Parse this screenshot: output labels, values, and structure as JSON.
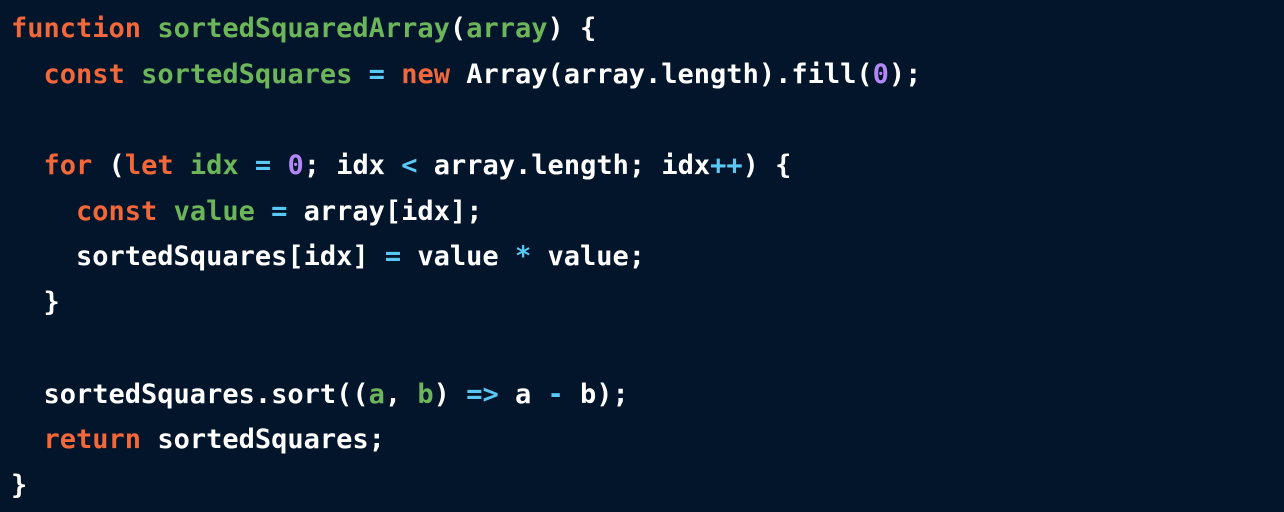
{
  "colors": {
    "background": "#02152a",
    "keyword": "#f2683b",
    "declaration": "#6cb55a",
    "operator": "#5ac8f5",
    "number": "#b387f7",
    "plain": "#ffffff"
  },
  "code": {
    "lines": [
      [
        {
          "text": "function",
          "kind": "kw"
        },
        {
          "text": " ",
          "kind": "id"
        },
        {
          "text": "sortedSquaredArray",
          "kind": "fn"
        },
        {
          "text": "(",
          "kind": "id"
        },
        {
          "text": "array",
          "kind": "fn"
        },
        {
          "text": ") {",
          "kind": "id"
        }
      ],
      [
        {
          "text": "  ",
          "kind": "id"
        },
        {
          "text": "const",
          "kind": "kw"
        },
        {
          "text": " ",
          "kind": "id"
        },
        {
          "text": "sortedSquares",
          "kind": "fn"
        },
        {
          "text": " ",
          "kind": "id"
        },
        {
          "text": "=",
          "kind": "op"
        },
        {
          "text": " ",
          "kind": "id"
        },
        {
          "text": "new",
          "kind": "kw"
        },
        {
          "text": " Array(array.length).fill(",
          "kind": "id"
        },
        {
          "text": "0",
          "kind": "num"
        },
        {
          "text": ");",
          "kind": "id"
        }
      ],
      [],
      [
        {
          "text": "  ",
          "kind": "id"
        },
        {
          "text": "for",
          "kind": "kw"
        },
        {
          "text": " (",
          "kind": "id"
        },
        {
          "text": "let",
          "kind": "kw"
        },
        {
          "text": " ",
          "kind": "id"
        },
        {
          "text": "idx",
          "kind": "fn"
        },
        {
          "text": " ",
          "kind": "id"
        },
        {
          "text": "=",
          "kind": "op"
        },
        {
          "text": " ",
          "kind": "id"
        },
        {
          "text": "0",
          "kind": "num"
        },
        {
          "text": "; idx ",
          "kind": "id"
        },
        {
          "text": "<",
          "kind": "op"
        },
        {
          "text": " array.length; idx",
          "kind": "id"
        },
        {
          "text": "++",
          "kind": "op"
        },
        {
          "text": ") {",
          "kind": "id"
        }
      ],
      [
        {
          "text": "    ",
          "kind": "id"
        },
        {
          "text": "const",
          "kind": "kw"
        },
        {
          "text": " ",
          "kind": "id"
        },
        {
          "text": "value",
          "kind": "fn"
        },
        {
          "text": " ",
          "kind": "id"
        },
        {
          "text": "=",
          "kind": "op"
        },
        {
          "text": " array[idx];",
          "kind": "id"
        }
      ],
      [
        {
          "text": "    sortedSquares[idx] ",
          "kind": "id"
        },
        {
          "text": "=",
          "kind": "op"
        },
        {
          "text": " value ",
          "kind": "id"
        },
        {
          "text": "*",
          "kind": "op"
        },
        {
          "text": " value;",
          "kind": "id"
        }
      ],
      [
        {
          "text": "  }",
          "kind": "id"
        }
      ],
      [],
      [
        {
          "text": "  sortedSquares.sort((",
          "kind": "id"
        },
        {
          "text": "a",
          "kind": "fn"
        },
        {
          "text": ", ",
          "kind": "id"
        },
        {
          "text": "b",
          "kind": "fn"
        },
        {
          "text": ") ",
          "kind": "id"
        },
        {
          "text": "=>",
          "kind": "op"
        },
        {
          "text": " a ",
          "kind": "id"
        },
        {
          "text": "-",
          "kind": "op"
        },
        {
          "text": " b);",
          "kind": "id"
        }
      ],
      [
        {
          "text": "  ",
          "kind": "id"
        },
        {
          "text": "return",
          "kind": "kw"
        },
        {
          "text": " sortedSquares;",
          "kind": "id"
        }
      ],
      [
        {
          "text": "}",
          "kind": "id"
        }
      ]
    ]
  }
}
